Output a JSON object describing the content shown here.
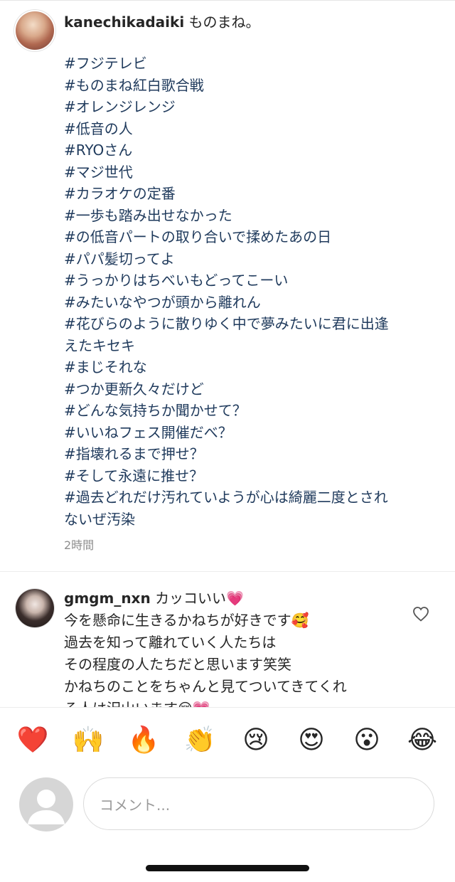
{
  "post": {
    "username": "kanechikadaiki",
    "caption_text": "ものまね。",
    "hashtags": [
      "#フジテレビ",
      "#ものまね紅白歌合戦",
      "#オレンジレンジ",
      "#低音の人",
      "#RYOさん",
      "#マジ世代",
      "#カラオケの定番",
      "#一歩も踏み出せなかった",
      "#の低音パートの取り合いで揉めたあの日",
      "#パパ髪切ってよ",
      "#うっかりはちべいもどってこーい",
      "#みたいなやつが頭から離れん",
      "#花びらのように散りゆく中で夢みたいに君に出逢",
      "えたキセキ",
      "#まじそれな",
      "#つか更新久々だけど",
      "#どんな気持ちか聞かせて？",
      "#いいねフェス開催だべ？",
      "#指壊れるまで押せ？",
      "#そして永遠に推せ？",
      "#過去どれだけ汚れていようが心は綺麗二度とされ",
      "ないぜ汚染"
    ],
    "timestamp": "2時間"
  },
  "comment": {
    "username": "gmgm_nxn",
    "lines": [
      "カッコいい💗",
      "今を懸命に生きるかねちが好きです🥰",
      "過去を知って離れていく人たちは",
      "その程度の人たちだと思います笑笑",
      "かねちのことをちゃんと見てついてきてくれ",
      "る人は沢山います😌💗"
    ]
  },
  "emoji_bar": [
    "❤️",
    "🙌",
    "🔥",
    "👏",
    "😢",
    "😍",
    "😮",
    "😂"
  ],
  "comment_input": {
    "placeholder": "コメント..."
  },
  "colors": {
    "hashtag": "#1f3a5c",
    "text": "#262626",
    "muted": "#8e8e8e",
    "heart": "#e8112d"
  }
}
